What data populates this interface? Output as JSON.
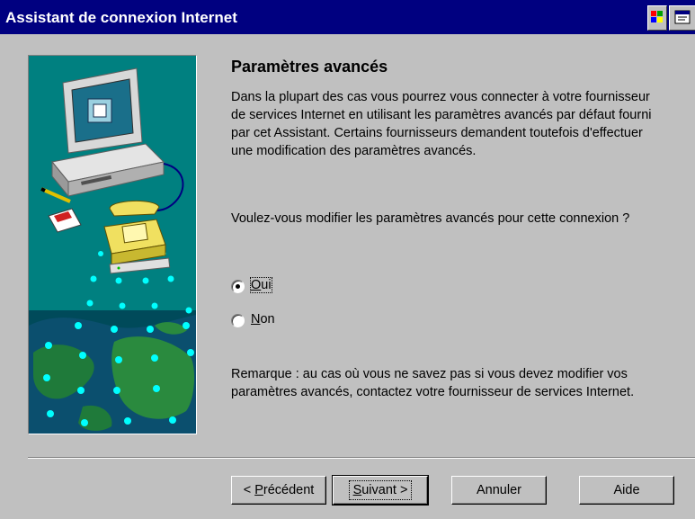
{
  "window": {
    "title": "Assistant de connexion Internet"
  },
  "heading": "Paramètres avancés",
  "intro": "Dans la plupart des cas vous pourrez vous connecter à votre fournisseur de services Internet en utilisant les paramètres avancés par défaut  fourni par cet Assistant. Certains fournisseurs demandent toutefois d'effectuer une modification des paramètres avancés.",
  "question": "Voulez-vous modifier les paramètres avancés pour cette connexion ?",
  "options": [
    {
      "label_mn": "O",
      "label_rest": "ui",
      "selected": true
    },
    {
      "label_mn": "N",
      "label_rest": "on",
      "selected": false
    }
  ],
  "note": "Remarque : au cas où vous ne savez pas si vous devez modifier vos paramètres avancés, contactez votre fournisseur de services Internet.",
  "buttons": {
    "back": {
      "pre": "< ",
      "mn": "P",
      "rest": "récédent"
    },
    "next": {
      "mn": "S",
      "rest": "uivant >"
    },
    "cancel": "Annuler",
    "help": "Aide"
  },
  "colors": {
    "titlebar": "#000080",
    "face": "#c0c0c0",
    "illustration_bg": "#008080"
  },
  "icons": [
    "windows-logo-icon",
    "system-menu-icon",
    "computer-illustration",
    "telephone-illustration",
    "globe-illustration"
  ]
}
